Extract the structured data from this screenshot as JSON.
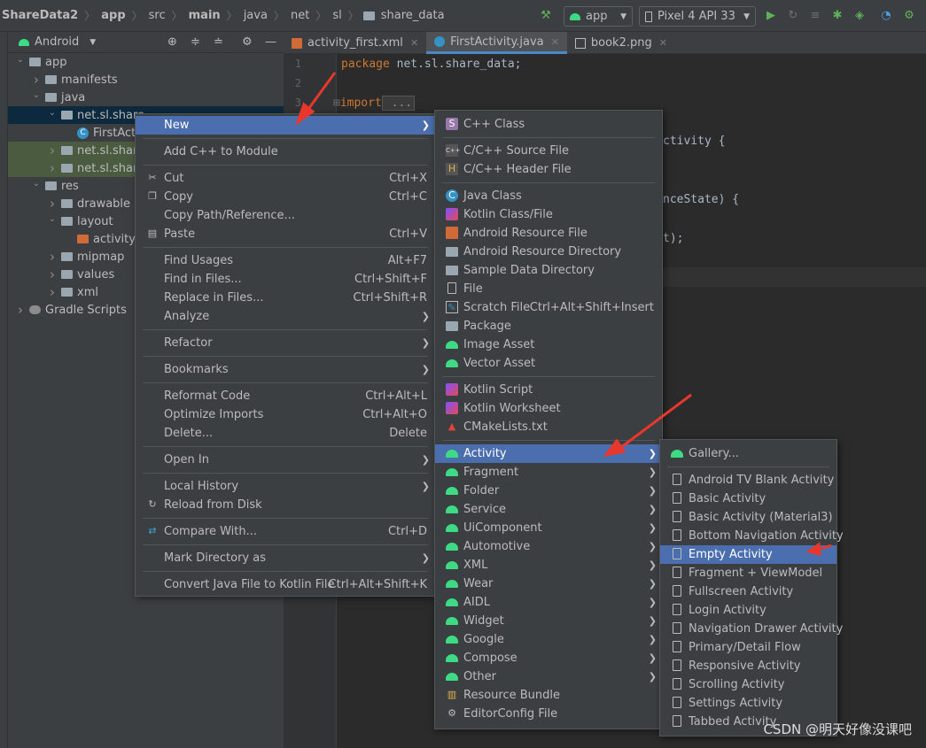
{
  "breadcrumbs": [
    "ShareData2",
    "app",
    "src",
    "main",
    "java",
    "net",
    "sl",
    "share_data"
  ],
  "toolbar": {
    "run_config": "app",
    "device": "Pixel 4 API 33"
  },
  "project_panel": {
    "view_mode": "Android",
    "tree": [
      {
        "label": "app",
        "depth": 0,
        "expanded": true,
        "icon": "module-folder-icon",
        "state": ""
      },
      {
        "label": "manifests",
        "depth": 1,
        "expanded": false,
        "icon": "folder-icon",
        "state": ""
      },
      {
        "label": "java",
        "depth": 1,
        "expanded": true,
        "icon": "folder-icon",
        "state": ""
      },
      {
        "label": "net.sl.share",
        "depth": 2,
        "expanded": true,
        "icon": "package-icon",
        "state": "selected"
      },
      {
        "label": "FirstActivi",
        "depth": 3,
        "expanded": null,
        "icon": "java-class-icon",
        "state": ""
      },
      {
        "label": "net.sl.share",
        "depth": 2,
        "expanded": false,
        "icon": "package-icon",
        "state": "highlight"
      },
      {
        "label": "net.sl.share",
        "depth": 2,
        "expanded": false,
        "icon": "package-icon",
        "state": "highlight"
      },
      {
        "label": "res",
        "depth": 1,
        "expanded": true,
        "icon": "folder-icon",
        "state": ""
      },
      {
        "label": "drawable",
        "depth": 2,
        "expanded": false,
        "icon": "folder-icon",
        "state": ""
      },
      {
        "label": "layout",
        "depth": 2,
        "expanded": true,
        "icon": "folder-icon",
        "state": ""
      },
      {
        "label": "activity_f",
        "depth": 3,
        "expanded": null,
        "icon": "xml-file-icon",
        "state": ""
      },
      {
        "label": "mipmap",
        "depth": 2,
        "expanded": false,
        "icon": "folder-icon",
        "state": ""
      },
      {
        "label": "values",
        "depth": 2,
        "expanded": false,
        "icon": "folder-icon",
        "state": ""
      },
      {
        "label": "xml",
        "depth": 2,
        "expanded": false,
        "icon": "folder-icon",
        "state": ""
      },
      {
        "label": "Gradle Scripts",
        "depth": 0,
        "expanded": false,
        "icon": "gradle-icon",
        "state": ""
      }
    ]
  },
  "editor": {
    "tabs": [
      {
        "label": "activity_first.xml",
        "active": false
      },
      {
        "label": "FirstActivity.java",
        "active": true
      },
      {
        "label": "book2.png",
        "active": false
      }
    ],
    "lines": [
      {
        "n": "1",
        "kw": "package",
        "text": " net.sl.share_data;"
      },
      {
        "n": "2",
        "kw": "",
        "text": ""
      },
      {
        "n": "3",
        "kw": "import",
        "text": " ..."
      }
    ],
    "fragments": [
      "ctivity {",
      "nceState) {",
      "t);"
    ]
  },
  "context_menu": [
    {
      "label": "New",
      "shortcut": "",
      "submenu": true,
      "active": true,
      "icon": ""
    },
    {
      "sep": true
    },
    {
      "label": "Add C++ to Module",
      "shortcut": "",
      "submenu": false,
      "icon": ""
    },
    {
      "sep": true
    },
    {
      "label": "Cut",
      "shortcut": "Ctrl+X",
      "submenu": false,
      "icon": "scissors-icon"
    },
    {
      "label": "Copy",
      "shortcut": "Ctrl+C",
      "submenu": false,
      "icon": "copy-icon"
    },
    {
      "label": "Copy Path/Reference...",
      "shortcut": "",
      "submenu": false,
      "icon": ""
    },
    {
      "label": "Paste",
      "shortcut": "Ctrl+V",
      "submenu": false,
      "icon": "paste-icon"
    },
    {
      "sep": true
    },
    {
      "label": "Find Usages",
      "shortcut": "Alt+F7",
      "submenu": false,
      "icon": ""
    },
    {
      "label": "Find in Files...",
      "shortcut": "Ctrl+Shift+F",
      "submenu": false,
      "icon": ""
    },
    {
      "label": "Replace in Files...",
      "shortcut": "Ctrl+Shift+R",
      "submenu": false,
      "icon": ""
    },
    {
      "label": "Analyze",
      "shortcut": "",
      "submenu": true,
      "icon": ""
    },
    {
      "sep": true
    },
    {
      "label": "Refactor",
      "shortcut": "",
      "submenu": true,
      "icon": ""
    },
    {
      "sep": true
    },
    {
      "label": "Bookmarks",
      "shortcut": "",
      "submenu": true,
      "icon": ""
    },
    {
      "sep": true
    },
    {
      "label": "Reformat Code",
      "shortcut": "Ctrl+Alt+L",
      "submenu": false,
      "icon": ""
    },
    {
      "label": "Optimize Imports",
      "shortcut": "Ctrl+Alt+O",
      "submenu": false,
      "icon": ""
    },
    {
      "label": "Delete...",
      "shortcut": "Delete",
      "submenu": false,
      "icon": ""
    },
    {
      "sep": true
    },
    {
      "label": "Open In",
      "shortcut": "",
      "submenu": true,
      "icon": ""
    },
    {
      "sep": true
    },
    {
      "label": "Local History",
      "shortcut": "",
      "submenu": true,
      "icon": ""
    },
    {
      "label": "Reload from Disk",
      "shortcut": "",
      "submenu": false,
      "icon": "reload-icon"
    },
    {
      "sep": true
    },
    {
      "label": "Compare With...",
      "shortcut": "Ctrl+D",
      "submenu": false,
      "icon": "compare-icon"
    },
    {
      "sep": true
    },
    {
      "label": "Mark Directory as",
      "shortcut": "",
      "submenu": true,
      "icon": ""
    },
    {
      "sep": true
    },
    {
      "label": "Convert Java File to Kotlin File",
      "shortcut": "Ctrl+Alt+Shift+K",
      "submenu": false,
      "icon": ""
    }
  ],
  "new_menu": [
    {
      "label": "C++ Class",
      "icon": "cpp-class-icon",
      "submenu": false,
      "shortcut": ""
    },
    {
      "sep": true
    },
    {
      "label": "C/C++ Source File",
      "icon": "cpp-source-icon",
      "submenu": false,
      "shortcut": ""
    },
    {
      "label": "C/C++ Header File",
      "icon": "cpp-header-icon",
      "submenu": false,
      "shortcut": ""
    },
    {
      "sep": true
    },
    {
      "label": "Java Class",
      "icon": "java-class-icon",
      "submenu": false,
      "shortcut": ""
    },
    {
      "label": "Kotlin Class/File",
      "icon": "kotlin-icon",
      "submenu": false,
      "shortcut": ""
    },
    {
      "label": "Android Resource File",
      "icon": "resource-file-icon",
      "submenu": false,
      "shortcut": ""
    },
    {
      "label": "Android Resource Directory",
      "icon": "folder-icon",
      "submenu": false,
      "shortcut": ""
    },
    {
      "label": "Sample Data Directory",
      "icon": "folder-icon",
      "submenu": false,
      "shortcut": ""
    },
    {
      "label": "File",
      "icon": "file-icon",
      "submenu": false,
      "shortcut": ""
    },
    {
      "label": "Scratch File",
      "icon": "scratch-icon",
      "submenu": false,
      "shortcut": "Ctrl+Alt+Shift+Insert"
    },
    {
      "label": "Package",
      "icon": "package-icon",
      "submenu": false,
      "shortcut": ""
    },
    {
      "label": "Image Asset",
      "icon": "android-icon",
      "submenu": false,
      "shortcut": ""
    },
    {
      "label": "Vector Asset",
      "icon": "android-icon",
      "submenu": false,
      "shortcut": ""
    },
    {
      "sep": true
    },
    {
      "label": "Kotlin Script",
      "icon": "kotlin-icon",
      "submenu": false,
      "shortcut": ""
    },
    {
      "label": "Kotlin Worksheet",
      "icon": "kotlin-icon",
      "submenu": false,
      "shortcut": ""
    },
    {
      "label": "CMakeLists.txt",
      "icon": "cmake-icon",
      "submenu": false,
      "shortcut": ""
    },
    {
      "sep": true
    },
    {
      "label": "Activity",
      "icon": "android-icon",
      "submenu": true,
      "active": true,
      "shortcut": ""
    },
    {
      "label": "Fragment",
      "icon": "android-icon",
      "submenu": true,
      "shortcut": ""
    },
    {
      "label": "Folder",
      "icon": "android-icon",
      "submenu": true,
      "shortcut": ""
    },
    {
      "label": "Service",
      "icon": "android-icon",
      "submenu": true,
      "shortcut": ""
    },
    {
      "label": "UiComponent",
      "icon": "android-icon",
      "submenu": true,
      "shortcut": ""
    },
    {
      "label": "Automotive",
      "icon": "android-icon",
      "submenu": true,
      "shortcut": ""
    },
    {
      "label": "XML",
      "icon": "android-icon",
      "submenu": true,
      "shortcut": ""
    },
    {
      "label": "Wear",
      "icon": "android-icon",
      "submenu": true,
      "shortcut": ""
    },
    {
      "label": "AIDL",
      "icon": "android-icon",
      "submenu": true,
      "shortcut": ""
    },
    {
      "label": "Widget",
      "icon": "android-icon",
      "submenu": true,
      "shortcut": ""
    },
    {
      "label": "Google",
      "icon": "android-icon",
      "submenu": true,
      "shortcut": ""
    },
    {
      "label": "Compose",
      "icon": "android-icon",
      "submenu": true,
      "shortcut": ""
    },
    {
      "label": "Other",
      "icon": "android-icon",
      "submenu": true,
      "shortcut": ""
    },
    {
      "label": "Resource Bundle",
      "icon": "resource-bundle-icon",
      "submenu": false,
      "shortcut": ""
    },
    {
      "label": "EditorConfig File",
      "icon": "gear-icon",
      "submenu": false,
      "shortcut": ""
    }
  ],
  "activity_menu": [
    {
      "label": "Gallery...",
      "icon": "android-icon"
    },
    {
      "sep": true
    },
    {
      "label": "Android TV Blank Activity",
      "icon": "template-icon"
    },
    {
      "label": "Basic Activity",
      "icon": "template-icon"
    },
    {
      "label": "Basic Activity (Material3)",
      "icon": "template-icon"
    },
    {
      "label": "Bottom Navigation Activity",
      "icon": "template-icon"
    },
    {
      "label": "Empty Activity",
      "icon": "template-icon",
      "active": true
    },
    {
      "label": "Fragment + ViewModel",
      "icon": "template-icon"
    },
    {
      "label": "Fullscreen Activity",
      "icon": "template-icon"
    },
    {
      "label": "Login Activity",
      "icon": "template-icon"
    },
    {
      "label": "Navigation Drawer Activity",
      "icon": "template-icon"
    },
    {
      "label": "Primary/Detail Flow",
      "icon": "template-icon"
    },
    {
      "label": "Responsive Activity",
      "icon": "template-icon"
    },
    {
      "label": "Scrolling Activity",
      "icon": "template-icon"
    },
    {
      "label": "Settings Activity",
      "icon": "template-icon"
    },
    {
      "label": "Tabbed Activity",
      "icon": "template-icon"
    }
  ],
  "watermark": "CSDN @明天好像没课吧",
  "colors": {
    "accent": "#4b6eaf",
    "annotation_arrow": "#e8382d",
    "android_green": "#3ddc84"
  }
}
